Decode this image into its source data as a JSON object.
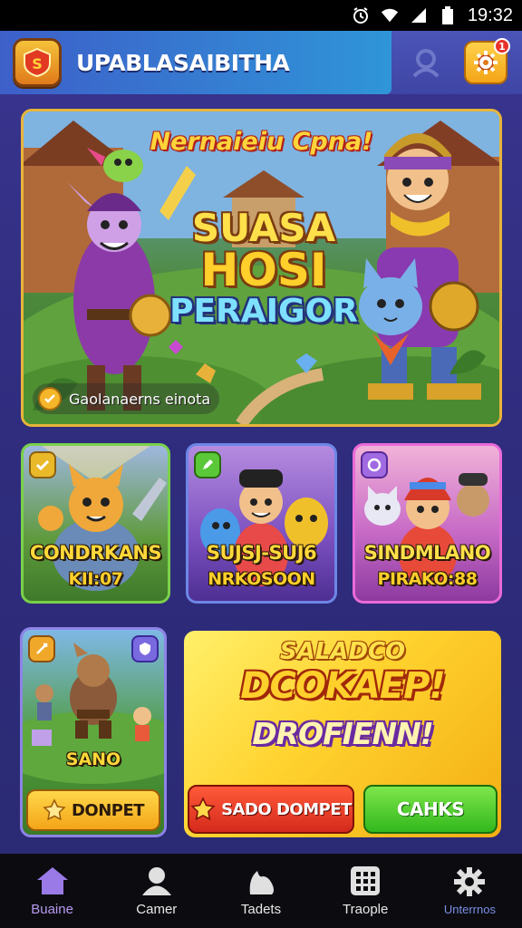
{
  "status_bar": {
    "time": "19:32"
  },
  "header": {
    "title": "UPABLASAIBITHA",
    "notification_count": "1"
  },
  "hero": {
    "headline": "Nernaieiu Cpna!",
    "line1": "SUASA",
    "line2": "HOSI",
    "line3": "PERAIGOR",
    "caption": "Gaolanaerns einota"
  },
  "cards": [
    {
      "line1": "CONDRKANS",
      "line2": "KII:07"
    },
    {
      "line1": "SUJSJ-SUJ6",
      "line2": "NRKOSOON"
    },
    {
      "line1": "SINDMLANO",
      "line2": "PIRAKO:88"
    }
  ],
  "card4": {
    "label": "SANO",
    "button": "DONPET"
  },
  "promo": {
    "line1": "SALADCO",
    "line2": "DCOKAEP!",
    "line3": "DROFIENN!",
    "button_red": "SADO DOMPET",
    "button_green": "CAHKS"
  },
  "bottom_nav": [
    {
      "label": "Buaine",
      "icon": "home-icon"
    },
    {
      "label": "Camer",
      "icon": "person-icon"
    },
    {
      "label": "Tadets",
      "icon": "hand-icon"
    },
    {
      "label": "Traople",
      "icon": "grid-icon"
    },
    {
      "label": "Unterrnos",
      "icon": "gear-icon"
    }
  ],
  "colors": {
    "accent": "#e7b53a",
    "primary": "#3d5fc9",
    "active_nav": "#b69af0"
  }
}
